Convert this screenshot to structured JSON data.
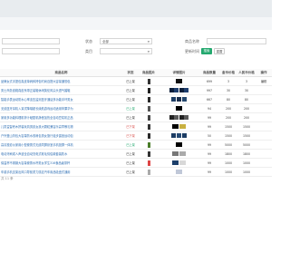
{
  "form": {
    "field1": {
      "label": "",
      "value": ""
    },
    "field2": {
      "label": "状态",
      "value": "全部"
    },
    "field3": {
      "label": "商品名称",
      "value": ""
    },
    "field4": {
      "label": "",
      "value": ""
    },
    "field5": {
      "label": "类目",
      "value": ""
    },
    "field6": {
      "label": "更新时间",
      "value": ""
    },
    "search_label": "搜索",
    "reset_label": "重置"
  },
  "table": {
    "headers": [
      "商品名称",
      "状态",
      "商品图片",
      "详情图片",
      "商品数量",
      "金币价格",
      "人民币价格",
      "操作"
    ],
    "rows": [
      {
        "title": "品牌女式手提包真皮单肩斜挎包时尚百搭大容量通勤包",
        "status": "已上架",
        "status_class": "st-ok",
        "thumb": "#333",
        "details": [
          "#111"
        ],
        "qty": "699",
        "gold": "3",
        "rmb": "3",
        "op": "编辑"
      },
      {
        "title": "男士商务皮鞋真皮系带正装鞋休闲英伦风尖头透气婚鞋",
        "status": "已上架",
        "status_class": "st-ok",
        "thumb": "#222",
        "details": [
          "#0b1e3a",
          "#1d3d6e",
          "#0b1e3a",
          "#1d3d6e"
        ],
        "qty": "997",
        "gold": "30",
        "rmb": "30"
      },
      {
        "title": "智能手表运动防水心率血压监测蓝牙通话多功能手环男女",
        "status": "已上架",
        "status_class": "st-ok",
        "thumb": "#2a2a2a",
        "details": [
          "#1f3f66",
          "#1a2f4d",
          "#26496f"
        ],
        "qty": "667",
        "gold": "80",
        "rmb": "80"
      },
      {
        "title": "无线蓝牙耳机入耳式降噪超长续航游戏运动适用苹果华为",
        "status": "已上架",
        "status_class": "st-green",
        "thumb": "#555",
        "details": [
          "#000"
        ],
        "qty": "94",
        "gold": "200",
        "rmb": "200"
      },
      {
        "title": "家用多功能料理机榨汁破壁机静音加热全自动豆浆机正品",
        "status": "已上架",
        "status_class": "st-ok",
        "thumb": "#444",
        "details": [
          "#222",
          "#5a5a5a",
          "#222",
          "#5a5a5a"
        ],
        "qty": "99",
        "gold": "200",
        "rmb": "200"
      },
      {
        "title": "儿童益智积木拼装玩具男孩女孩大颗粒兼容乐高早教礼物",
        "status": "已下架",
        "status_class": "st-warn",
        "thumb": "#333",
        "details": [
          "#000",
          "#c8b040"
        ],
        "qty": "99",
        "gold": "1500",
        "rmb": "1500"
      },
      {
        "title": "户外登山背包大容量防水双肩包男女旅行徒步露营运动包",
        "status": "已下架",
        "status_class": "st-warn",
        "thumb": "#2a2a2a",
        "details": [
          "#1b3c63",
          "#264b75",
          "#1b3c63"
        ],
        "qty": "50",
        "gold": "1500",
        "rmb": "1500"
      },
      {
        "title": "高清投影仪家用小型便携式无线同屏卧室手机投屏一体机",
        "status": "已上架",
        "status_class": "st-green",
        "thumb": "#4a7d2a",
        "details": [
          "#000"
        ],
        "qty": "99",
        "gold": "5000",
        "rmb": "5000"
      },
      {
        "title": "电动牙刷成人声波全自动充电式软毛情侣款套装防水",
        "status": "已上架",
        "status_class": "st-ok",
        "thumb": "#333",
        "details": [
          "#777",
          "#aaa"
        ],
        "qty": "99",
        "gold": "1800",
        "rmb": "1800"
      },
      {
        "title": "保温杯不锈钢大容量便携水杯男女学生316食品级茶杯",
        "status": "已上架",
        "status_class": "st-ok",
        "thumb": "#d44",
        "details": [
          "#1c3f6b",
          "#d8d8d8"
        ],
        "qty": "99",
        "gold": "1000",
        "rmb": "1000"
      },
      {
        "title": "车载手机支架出风口导航重力感应汽车用品吸盘式通用",
        "status": "已上架",
        "status_class": "st-ok",
        "thumb": "#aaa",
        "details": [
          "#c0c8d8"
        ],
        "qty": "99",
        "gold": "1000",
        "rmb": "1000"
      }
    ]
  },
  "footer": "共 11 条"
}
